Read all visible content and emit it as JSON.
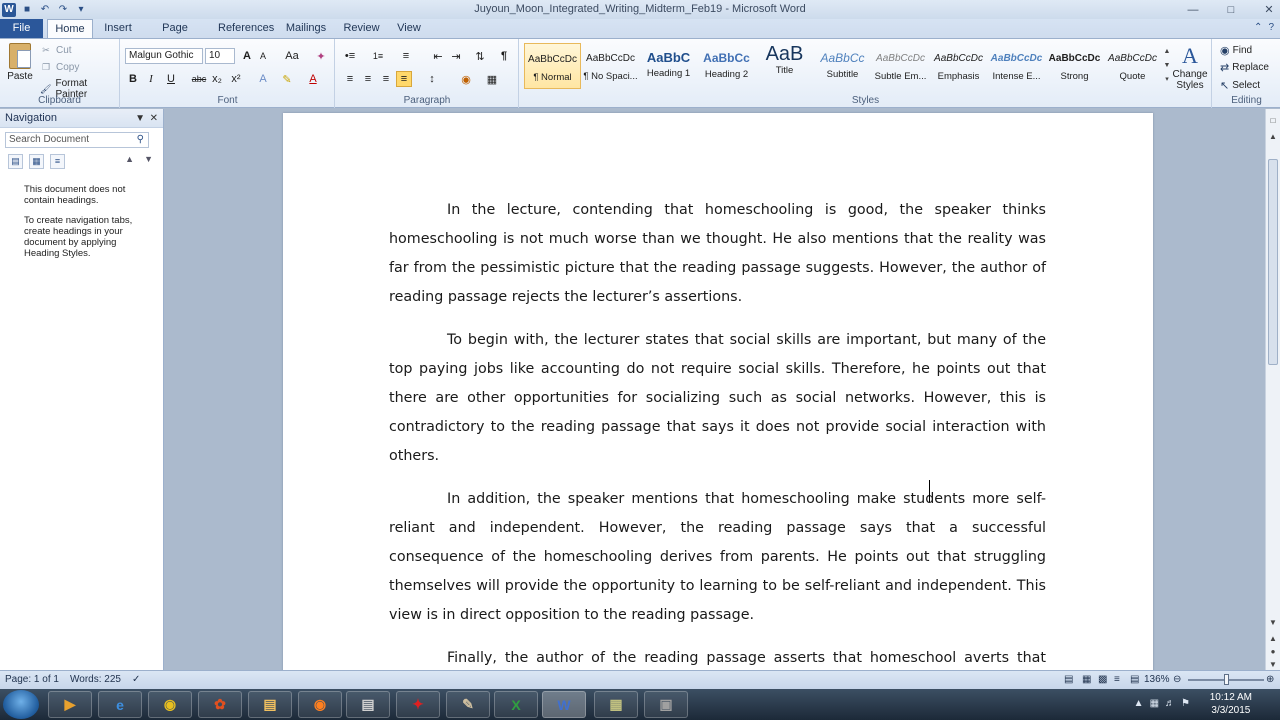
{
  "window": {
    "title": "Juyoun_Moon_Integrated_Writing_Midterm_Feb19 - Microsoft Word"
  },
  "tabs": [
    "File",
    "Home",
    "Insert",
    "Page Layout",
    "References",
    "Mailings",
    "Review",
    "View"
  ],
  "clipboard": {
    "paste": "Paste",
    "cut": "Cut",
    "copy": "Copy",
    "format_painter": "Format Painter",
    "label": "Clipboard"
  },
  "font": {
    "name": "Malgun Gothic",
    "size": "10",
    "label": "Font",
    "bold": "B",
    "italic": "I",
    "underline": "U",
    "strike": "abc",
    "subscript": "x₂",
    "superscript": "x²",
    "grow": "A",
    "shrink": "A",
    "change_case": "Aa",
    "font_color": "A"
  },
  "paragraph": {
    "label": "Paragraph",
    "pilcrow": "¶"
  },
  "styles": {
    "label": "Styles",
    "items": [
      {
        "sample": "AaBbCcDc",
        "name": "¶ Normal"
      },
      {
        "sample": "AaBbCcDc",
        "name": "¶ No Spaci..."
      },
      {
        "sample": "AaBbC",
        "name": "Heading 1"
      },
      {
        "sample": "AaBbCc",
        "name": "Heading 2"
      },
      {
        "sample": "AaB",
        "name": "Title"
      },
      {
        "sample": "AaBbCc",
        "name": "Subtitle"
      },
      {
        "sample": "AaBbCcDc",
        "name": "Subtle Em..."
      },
      {
        "sample": "AaBbCcDc",
        "name": "Emphasis"
      },
      {
        "sample": "AaBbCcDc",
        "name": "Intense E..."
      },
      {
        "sample": "AaBbCcDc",
        "name": "Strong"
      },
      {
        "sample": "AaBbCcDc",
        "name": "Quote"
      }
    ],
    "change_styles": "Change Styles"
  },
  "editing": {
    "label": "Editing",
    "find": "Find",
    "replace": "Replace",
    "select": "Select"
  },
  "navigation": {
    "title": "Navigation",
    "search_placeholder": "Search Document",
    "message1": "This document does not contain headings.",
    "message2": "To create navigation tabs, create headings in your document by applying Heading Styles."
  },
  "document": {
    "paragraphs": [
      "In the lecture, contending that homeschooling is good, the speaker thinks homeschooling is not much worse than we thought. He also mentions that the reality was far from the pessimistic picture that the reading passage suggests. However, the author of reading passage rejects the lecturer’s assertions.",
      "To begin with, the lecturer states that social skills are important, but many of the top paying jobs like accounting do not require social skills. Therefore, he points out that there are other opportunities for socializing such as social networks. However, this is contradictory to the reading passage that says it does not provide social interaction with others.",
      "In addition, the speaker mentions that homeschooling make students more self-reliant and independent. However, the reading passage says that a successful consequence of the homeschooling derives from parents. He points out that struggling themselves will provide the opportunity to learning to be self-reliant and independent. This view is in direct opposition to the reading passage.",
      "Finally, the author of the reading passage asserts that homeschool averts that being punctual and responsible. On the other hand, the speaker of the lecture believes that"
    ]
  },
  "status": {
    "page": "Page: 1 of 1",
    "words": "Words: 225",
    "zoom": "136%"
  },
  "taskbar": {
    "time": "10:12 AM",
    "date": "3/3/2015"
  }
}
